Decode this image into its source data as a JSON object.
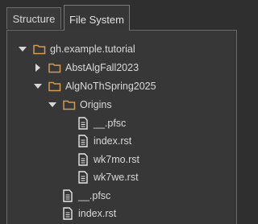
{
  "tabs": [
    {
      "label": "Structure",
      "active": false
    },
    {
      "label": "File System",
      "active": true
    }
  ],
  "tree": {
    "root": {
      "label": "gh.example.tutorial",
      "expanded": true
    },
    "abst": {
      "label": "AbstAlgFall2023",
      "expanded": false
    },
    "algno": {
      "label": "AlgNoThSpring2025",
      "expanded": true
    },
    "origins": {
      "label": "Origins",
      "expanded": true
    },
    "origins_files": [
      {
        "label": "__.pfsc"
      },
      {
        "label": "index.rst"
      },
      {
        "label": "wk7mo.rst"
      },
      {
        "label": "wk7we.rst"
      }
    ],
    "algno_files": [
      {
        "label": "__.pfsc"
      },
      {
        "label": "index.rst"
      }
    ]
  },
  "colors": {
    "folder": "#d39a52",
    "file": "#e6e6e6",
    "text": "#d9d9d9",
    "background": "#373737"
  }
}
